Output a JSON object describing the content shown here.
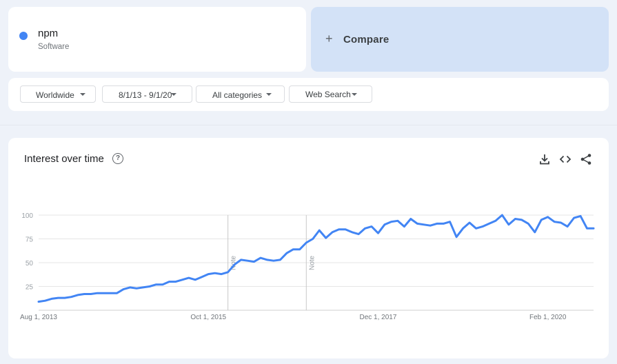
{
  "term": {
    "name": "npm",
    "type": "Software",
    "color": "#4285f4"
  },
  "compare": {
    "label": "Compare"
  },
  "filters": [
    {
      "label": "Worldwide"
    },
    {
      "label": "8/1/13 - 9/1/20"
    },
    {
      "label": "All categories"
    },
    {
      "label": "Web Search"
    }
  ],
  "chart": {
    "title": "Interest over time",
    "actions": [
      "download-icon",
      "embed-icon",
      "share-icon"
    ]
  },
  "chart_data": {
    "type": "line",
    "title": "Interest over time",
    "xlabel": "",
    "ylabel": "",
    "ylim": [
      0,
      100
    ],
    "yticks": [
      25,
      50,
      75,
      100
    ],
    "grid": true,
    "line_color": "#4285f4",
    "x_start": "2013-08",
    "x_end": "2020-09",
    "x_tick_labels": [
      {
        "label": "Aug 1, 2013",
        "x": "2013-08"
      },
      {
        "label": "Oct 1, 2015",
        "x": "2015-10"
      },
      {
        "label": "Dec 1, 2017",
        "x": "2017-12"
      },
      {
        "label": "Feb 1, 2020",
        "x": "2020-02"
      }
    ],
    "notes": [
      {
        "label": "Note",
        "x": "2016-01"
      },
      {
        "label": "Note",
        "x": "2017-01"
      }
    ],
    "series": [
      {
        "values": [
          9,
          10,
          12,
          13,
          13,
          14,
          16,
          17,
          17,
          18,
          18,
          18,
          18,
          22,
          24,
          23,
          24,
          25,
          27,
          27,
          30,
          30,
          32,
          34,
          32,
          35,
          38,
          39,
          38,
          40,
          48,
          53,
          52,
          51,
          55,
          53,
          52,
          53,
          60,
          64,
          64,
          71,
          75,
          84,
          76,
          82,
          85,
          85,
          82,
          80,
          86,
          88,
          81,
          90,
          93,
          94,
          88,
          96,
          91,
          90,
          89,
          91,
          91,
          93,
          77,
          86,
          92,
          86,
          88,
          91,
          94,
          100,
          90,
          96,
          95,
          91,
          82,
          95,
          98,
          93,
          92,
          88,
          97,
          99,
          86,
          86
        ]
      }
    ]
  }
}
